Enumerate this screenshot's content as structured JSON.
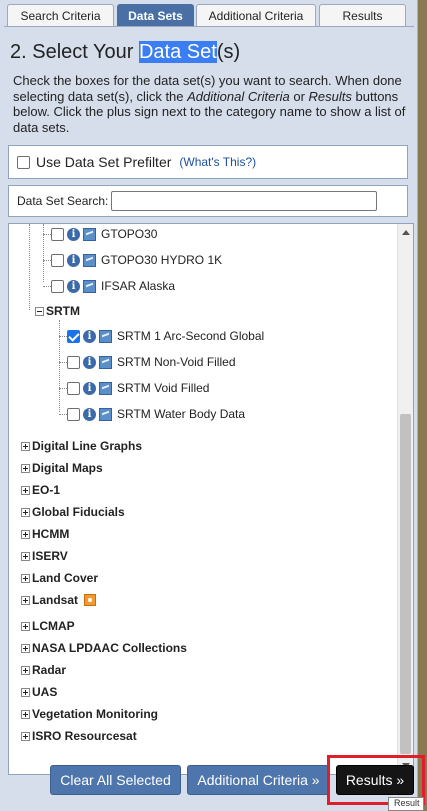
{
  "tabs": [
    "Search Criteria",
    "Data Sets",
    "Additional Criteria",
    "Results"
  ],
  "active_tab": "Data Sets",
  "title": {
    "prefix": "2. Select Your ",
    "highlight": "Data Set",
    "suffix": "(s)"
  },
  "instructions": {
    "part1": "Check the boxes for the data set(s) you want to search. When done selecting data set(s), click the ",
    "italic1": "Additional Criteria",
    "part2": " or ",
    "italic2": "Results",
    "part3": " buttons below. Click the plus sign next to the category name to show a list of data sets."
  },
  "prefilter": {
    "label": "Use Data Set Prefilter",
    "link": "(What's This?)",
    "checked": false
  },
  "search": {
    "label": "Data Set Search:",
    "value": ""
  },
  "tree": {
    "top_items": [
      {
        "label": "GTOPO30",
        "checked": false
      },
      {
        "label": "GTOPO30 HYDRO 1K",
        "checked": false
      },
      {
        "label": "IFSAR Alaska",
        "checked": false
      }
    ],
    "srtm": {
      "label": "SRTM",
      "items": [
        {
          "label": "SRTM 1 Arc-Second Global",
          "checked": true
        },
        {
          "label": "SRTM Non-Void Filled",
          "checked": false
        },
        {
          "label": "SRTM Void Filled",
          "checked": false
        },
        {
          "label": "SRTM Water Body Data",
          "checked": false
        }
      ]
    },
    "categories": [
      "Digital Line Graphs",
      "Digital Maps",
      "EO-1",
      "Global Fiducials",
      "HCMM",
      "ISERV",
      "Land Cover",
      "Landsat",
      "LCMAP",
      "NASA LPDAAC Collections",
      "Radar",
      "UAS",
      "Vegetation Monitoring",
      "ISRO Resourcesat"
    ]
  },
  "buttons": {
    "clear": "Clear All Selected",
    "additional": "Additional Criteria »",
    "results": "Results »"
  },
  "tooltip": "Result"
}
